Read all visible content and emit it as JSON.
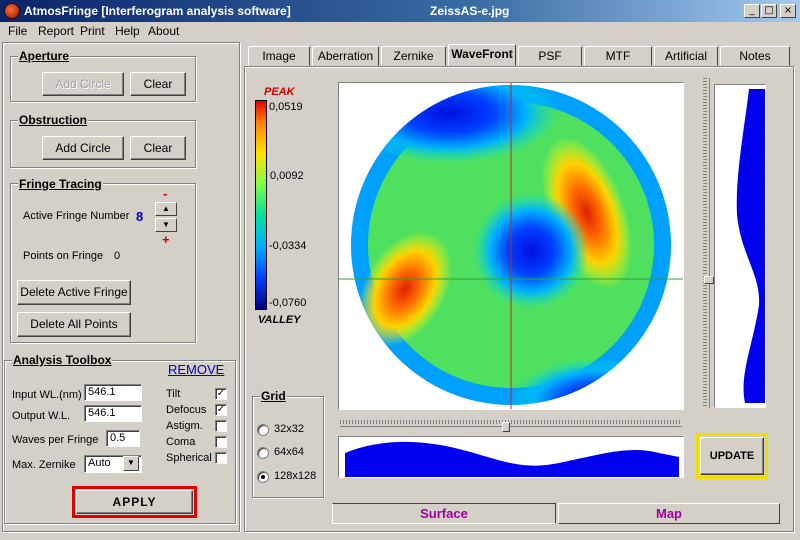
{
  "window": {
    "title": "AtmosFringe  [Interferogram analysis software]",
    "file_name": "ZeissAS-e.jpg",
    "minimize": "_",
    "maximize": "□",
    "close": "×"
  },
  "menu": [
    "File",
    "Report",
    "Print",
    "Help",
    "About"
  ],
  "aperture": {
    "title": "Aperture",
    "add_label": "Add Circle",
    "clear_label": "Clear"
  },
  "obstruction": {
    "title": "Obstruction",
    "add_label": "Add Circle",
    "clear_label": "Clear"
  },
  "fringe_tracing": {
    "title": "Fringe Tracing",
    "active_label": "Active Fringe Number",
    "active_value": "8",
    "minus": "-",
    "plus": "+",
    "points_label": "Points on  Fringe",
    "points_value": "0",
    "delete_active_label": "Delete Active Fringe",
    "delete_all_label": "Delete  All  Points"
  },
  "analysis": {
    "title": "Analysis Toolbox",
    "remove_label": "REMOVE",
    "input_wl_label": "Input WL.(nm)",
    "input_wl_value": "546.1",
    "output_wl_label": "Output W.L.",
    "output_wl_value": "546.1",
    "waves_label": "Waves per Fringe",
    "waves_value": "0.5",
    "zernike_label": "Max. Zernike",
    "zernike_value": "Auto",
    "apply_label": "APPLY",
    "checks": [
      {
        "label": "Tilt",
        "checked": true
      },
      {
        "label": "Defocus",
        "checked": true
      },
      {
        "label": "Astigm.",
        "checked": false
      },
      {
        "label": "Coma",
        "checked": false
      },
      {
        "label": "Spherical",
        "checked": false
      }
    ]
  },
  "tabs": [
    "Image",
    "Aberration",
    "Zernike",
    "WaveFront",
    "PSF",
    "MTF",
    "Artificial",
    "Notes"
  ],
  "active_tab": "WaveFront",
  "scale": {
    "peak_label": "PEAK",
    "valley_label": "VALLEY",
    "ticks": [
      "0,0519",
      "0,0092",
      "-0,0334",
      "-0,0760"
    ]
  },
  "grid": {
    "title": "Grid",
    "options": [
      "32x32",
      "64x64",
      "128x128"
    ],
    "selected": "128x128"
  },
  "update_label": "UPDATE",
  "bottom_tabs": {
    "surface": "Surface",
    "map": "Map"
  },
  "colors": {
    "tab_text": "#a000a0",
    "peak_text": "#d00000",
    "value_blue": "#0000c0",
    "profile_blue": "#0000ee",
    "apply_border": "#e00000",
    "update_border": "#f0e000",
    "crosshair_v": "#d02020",
    "crosshair_h": "#30a030"
  }
}
